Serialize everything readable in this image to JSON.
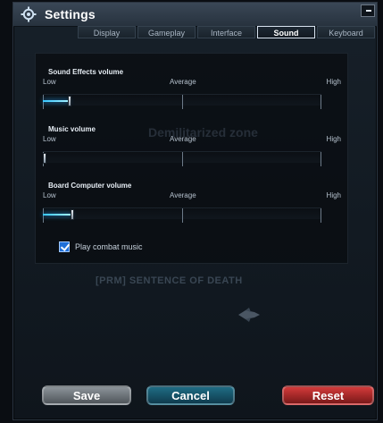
{
  "window": {
    "title": "Settings",
    "icons": {
      "settings": "gear-icon",
      "close": "minimize-close-icon"
    }
  },
  "tabs": [
    {
      "label": "Display",
      "active": false
    },
    {
      "label": "Gameplay",
      "active": false
    },
    {
      "label": "Interface",
      "active": false
    },
    {
      "label": "Sound",
      "active": true
    },
    {
      "label": "Keyboard",
      "active": false
    }
  ],
  "background": {
    "zone_text": "Demilitarized zone",
    "clan_tag": "[PRM] SENTENCE OF DEATH"
  },
  "sliders": [
    {
      "title": "Sound Effects volume",
      "low": "Low",
      "average": "Average",
      "high": "High",
      "value_fraction": 0.09
    },
    {
      "title": "Music volume",
      "low": "Low",
      "average": "Average",
      "high": "High",
      "value_fraction": 0.0
    },
    {
      "title": "Board Computer volume",
      "low": "Low",
      "average": "Average",
      "high": "High",
      "value_fraction": 0.1
    }
  ],
  "options": {
    "combat_music": {
      "label": "Play combat music",
      "checked": true
    }
  },
  "buttons": {
    "save": "Save",
    "cancel": "Cancel",
    "reset": "Reset"
  },
  "colors": {
    "accent_glow": "#35c6ff",
    "save": "#7a8187",
    "cancel": "#1b5d73",
    "reset": "#b22a2a"
  }
}
